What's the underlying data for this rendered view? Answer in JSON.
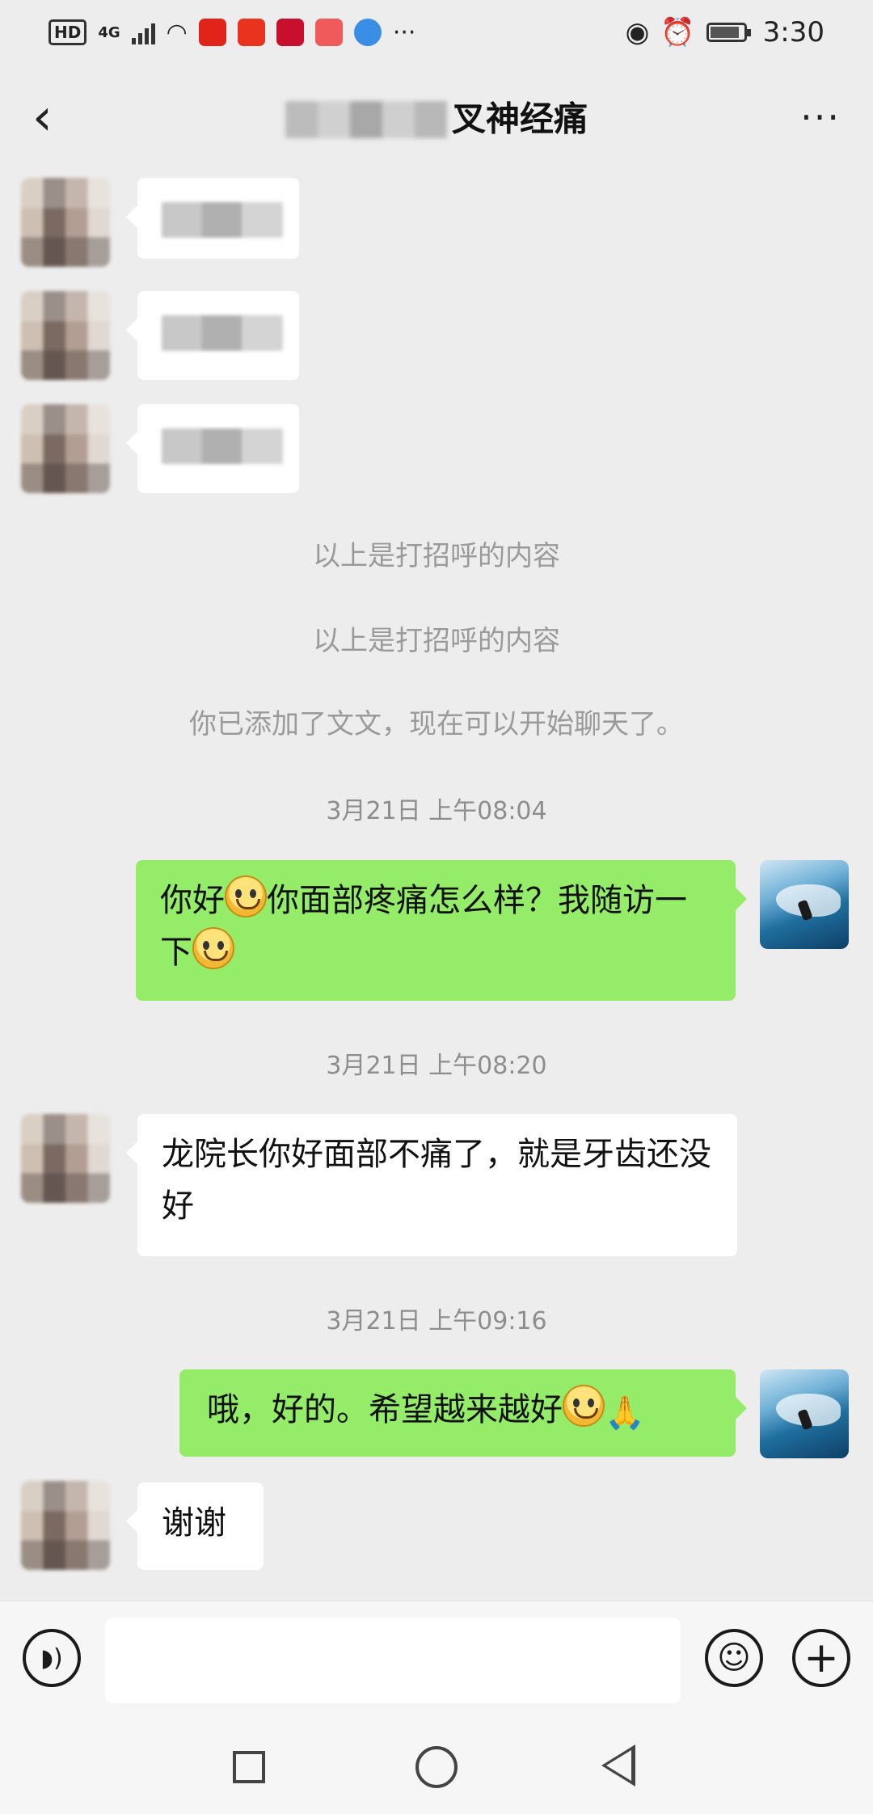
{
  "status_bar": {
    "hd_label": "HD",
    "network_label": "4G",
    "more_dots": "···",
    "time": "3:30",
    "icons": [
      "hd-icon",
      "signal-icon",
      "wifi-icon",
      "weibo-icon",
      "app-icon",
      "app-icon",
      "reader-icon",
      "browser-icon",
      "eye-icon",
      "alarm-icon",
      "battery-icon"
    ]
  },
  "header": {
    "title_visible": "叉神经痛",
    "more_label": "···",
    "back_label": "‹"
  },
  "system_messages": [
    "以上是打招呼的内容",
    "以上是打招呼的内容",
    "你已添加了文文，现在可以开始聊天了。"
  ],
  "timestamps": [
    "3月21日 上午08:04",
    "3月21日 上午08:20",
    "3月21日 上午09:16"
  ],
  "messages": {
    "m1_part1": "你好",
    "m1_part2": "你面部疼痛怎么样？我随访一下",
    "m2": "龙院长你好面部不痛了，就是牙齿还没好",
    "m3": "哦，好的。希望越来越好",
    "m4": "谢谢"
  },
  "colors": {
    "background": "#ededed",
    "sent_bubble": "#95ec69",
    "received_bubble": "#ffffff",
    "system_text": "#9a9a9a"
  }
}
